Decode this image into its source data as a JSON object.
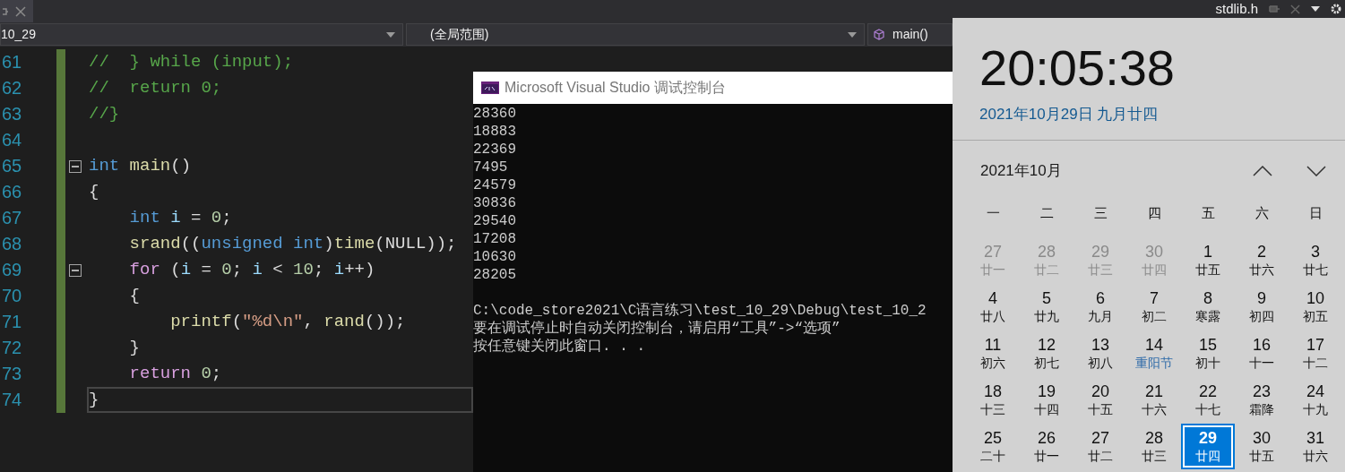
{
  "tab_bar": {
    "file_tab": "stdlib.h"
  },
  "navigation": {
    "project": "10_29",
    "scope": "(全局范围)",
    "member": "main()"
  },
  "editor": {
    "lines": [
      {
        "number": "61",
        "fold": false,
        "current": false,
        "tokens": [
          {
            "text": "//  } while (input);",
            "kind": "comment"
          }
        ]
      },
      {
        "number": "62",
        "fold": false,
        "current": false,
        "tokens": [
          {
            "text": "//  return 0;",
            "kind": "comment"
          }
        ]
      },
      {
        "number": "63",
        "fold": false,
        "current": false,
        "tokens": [
          {
            "text": "//}",
            "kind": "comment"
          }
        ]
      },
      {
        "number": "64",
        "fold": false,
        "current": false
      },
      {
        "number": "65",
        "fold": true,
        "current": false,
        "tokens": [
          {
            "text": "int",
            "kind": "keyword"
          },
          {
            "text": " main",
            "kind": "function"
          },
          {
            "text": "()",
            "kind": "plain"
          }
        ]
      },
      {
        "number": "66",
        "fold": false,
        "current": false,
        "tokens": [
          {
            "text": "{",
            "kind": "plain"
          }
        ]
      },
      {
        "number": "67",
        "fold": false,
        "current": false,
        "tokens": [
          {
            "text": "    int",
            "kind": "keyword"
          },
          {
            "text": " i",
            "kind": "variable"
          },
          {
            "text": " = ",
            "kind": "plain"
          },
          {
            "text": "0",
            "kind": "number"
          },
          {
            "text": ";",
            "kind": "plain"
          }
        ]
      },
      {
        "number": "68",
        "fold": false,
        "current": false,
        "tokens": [
          {
            "text": "    srand",
            "kind": "function"
          },
          {
            "text": "((",
            "kind": "plain"
          },
          {
            "text": "unsigned int",
            "kind": "keyword"
          },
          {
            "text": ")",
            "kind": "plain"
          },
          {
            "text": "time",
            "kind": "function"
          },
          {
            "text": "(NULL));",
            "kind": "plain"
          }
        ]
      },
      {
        "number": "69",
        "fold": true,
        "current": false,
        "tokens": [
          {
            "text": "    for",
            "kind": "control"
          },
          {
            "text": " (",
            "kind": "plain"
          },
          {
            "text": "i",
            "kind": "variable"
          },
          {
            "text": " = ",
            "kind": "plain"
          },
          {
            "text": "0",
            "kind": "number"
          },
          {
            "text": "; ",
            "kind": "plain"
          },
          {
            "text": "i",
            "kind": "variable"
          },
          {
            "text": " < ",
            "kind": "plain"
          },
          {
            "text": "10",
            "kind": "number"
          },
          {
            "text": "; ",
            "kind": "plain"
          },
          {
            "text": "i",
            "kind": "variable"
          },
          {
            "text": "++)",
            "kind": "plain"
          }
        ]
      },
      {
        "number": "70",
        "fold": false,
        "current": false,
        "tokens": [
          {
            "text": "    {",
            "kind": "plain"
          }
        ]
      },
      {
        "number": "71",
        "fold": false,
        "current": false,
        "tokens": [
          {
            "text": "        printf",
            "kind": "function"
          },
          {
            "text": "(",
            "kind": "plain"
          },
          {
            "text": "\"%d\\n\"",
            "kind": "string"
          },
          {
            "text": ", ",
            "kind": "plain"
          },
          {
            "text": "rand",
            "kind": "function"
          },
          {
            "text": "());",
            "kind": "plain"
          }
        ]
      },
      {
        "number": "72",
        "fold": false,
        "current": false,
        "tokens": [
          {
            "text": "    }",
            "kind": "plain"
          }
        ]
      },
      {
        "number": "73",
        "fold": false,
        "current": false,
        "tokens": [
          {
            "text": "    return",
            "kind": "control"
          },
          {
            "text": " 0",
            "kind": "number"
          },
          {
            "text": ";",
            "kind": "plain"
          }
        ]
      },
      {
        "number": "74",
        "fold": false,
        "current": true,
        "tokens": [
          {
            "text": "}",
            "kind": "plain"
          }
        ]
      }
    ]
  },
  "console": {
    "title": "Microsoft Visual Studio 调试控制台",
    "numbers": [
      "28360",
      "18883",
      "22369",
      "7495",
      "24579",
      "30836",
      "29540",
      "17208",
      "10630",
      "28205"
    ],
    "messages": [
      "C:\\code_store2021\\C语言练习\\test_10_29\\Debug\\test_10_2",
      "要在调试停止时自动关闭控制台，请启用“工具”->“选项”",
      "按任意键关闭此窗口. . ."
    ]
  },
  "clock": {
    "time": "20:05:38",
    "date": "2021年10月29日 九月廿四"
  },
  "calendar": {
    "month": "2021年10月",
    "weekdays": [
      "一",
      "二",
      "三",
      "四",
      "五",
      "六",
      "日"
    ],
    "days": [
      {
        "day": "27",
        "lunar": "廿一",
        "in_month": false,
        "selected": false,
        "festival": false
      },
      {
        "day": "28",
        "lunar": "廿二",
        "in_month": false,
        "selected": false,
        "festival": false
      },
      {
        "day": "29",
        "lunar": "廿三",
        "in_month": false,
        "selected": false,
        "festival": false
      },
      {
        "day": "30",
        "lunar": "廿四",
        "in_month": false,
        "selected": false,
        "festival": false
      },
      {
        "day": "1",
        "lunar": "廿五",
        "in_month": true,
        "selected": false,
        "festival": false
      },
      {
        "day": "2",
        "lunar": "廿六",
        "in_month": true,
        "selected": false,
        "festival": false
      },
      {
        "day": "3",
        "lunar": "廿七",
        "in_month": true,
        "selected": false,
        "festival": false
      },
      {
        "day": "4",
        "lunar": "廿八",
        "in_month": true,
        "selected": false,
        "festival": false
      },
      {
        "day": "5",
        "lunar": "廿九",
        "in_month": true,
        "selected": false,
        "festival": false
      },
      {
        "day": "6",
        "lunar": "九月",
        "in_month": true,
        "selected": false,
        "festival": false
      },
      {
        "day": "7",
        "lunar": "初二",
        "in_month": true,
        "selected": false,
        "festival": false
      },
      {
        "day": "8",
        "lunar": "寒露",
        "in_month": true,
        "selected": false,
        "festival": false
      },
      {
        "day": "9",
        "lunar": "初四",
        "in_month": true,
        "selected": false,
        "festival": false
      },
      {
        "day": "10",
        "lunar": "初五",
        "in_month": true,
        "selected": false,
        "festival": false
      },
      {
        "day": "11",
        "lunar": "初六",
        "in_month": true,
        "selected": false,
        "festival": false
      },
      {
        "day": "12",
        "lunar": "初七",
        "in_month": true,
        "selected": false,
        "festival": false
      },
      {
        "day": "13",
        "lunar": "初八",
        "in_month": true,
        "selected": false,
        "festival": false
      },
      {
        "day": "14",
        "lunar": "重阳节",
        "in_month": true,
        "selected": false,
        "festival": true
      },
      {
        "day": "15",
        "lunar": "初十",
        "in_month": true,
        "selected": false,
        "festival": false
      },
      {
        "day": "16",
        "lunar": "十一",
        "in_month": true,
        "selected": false,
        "festival": false
      },
      {
        "day": "17",
        "lunar": "十二",
        "in_month": true,
        "selected": false,
        "festival": false
      },
      {
        "day": "18",
        "lunar": "十三",
        "in_month": true,
        "selected": false,
        "festival": false
      },
      {
        "day": "19",
        "lunar": "十四",
        "in_month": true,
        "selected": false,
        "festival": false
      },
      {
        "day": "20",
        "lunar": "十五",
        "in_month": true,
        "selected": false,
        "festival": false
      },
      {
        "day": "21",
        "lunar": "十六",
        "in_month": true,
        "selected": false,
        "festival": false
      },
      {
        "day": "22",
        "lunar": "十七",
        "in_month": true,
        "selected": false,
        "festival": false
      },
      {
        "day": "23",
        "lunar": "霜降",
        "in_month": true,
        "selected": false,
        "festival": false
      },
      {
        "day": "24",
        "lunar": "十九",
        "in_month": true,
        "selected": false,
        "festival": false
      },
      {
        "day": "25",
        "lunar": "二十",
        "in_month": true,
        "selected": false,
        "festival": false
      },
      {
        "day": "26",
        "lunar": "廿一",
        "in_month": true,
        "selected": false,
        "festival": false
      },
      {
        "day": "27",
        "lunar": "廿二",
        "in_month": true,
        "selected": false,
        "festival": false
      },
      {
        "day": "28",
        "lunar": "廿三",
        "in_month": true,
        "selected": false,
        "festival": false
      },
      {
        "day": "29",
        "lunar": "廿四",
        "in_month": true,
        "selected": true,
        "festival": false
      },
      {
        "day": "30",
        "lunar": "廿五",
        "in_month": true,
        "selected": false,
        "festival": false
      },
      {
        "day": "31",
        "lunar": "廿六",
        "in_month": true,
        "selected": false,
        "festival": false
      }
    ]
  }
}
